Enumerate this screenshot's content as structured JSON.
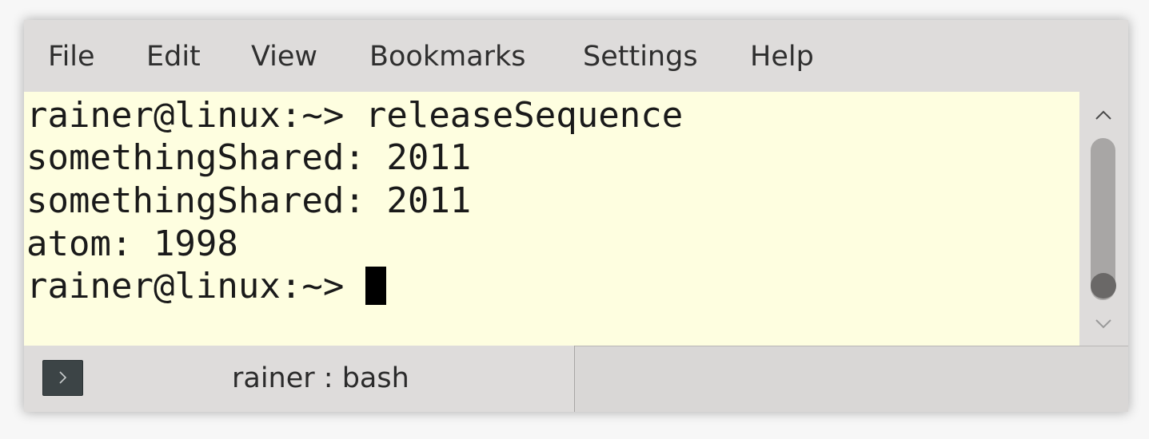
{
  "menubar": {
    "items": [
      {
        "label": "File"
      },
      {
        "label": "Edit"
      },
      {
        "label": "View"
      },
      {
        "label": "Bookmarks"
      },
      {
        "label": "Settings"
      },
      {
        "label": "Help"
      }
    ]
  },
  "terminal": {
    "lines": [
      "rainer@linux:~> releaseSequence",
      "somethingShared: 2011",
      "somethingShared: 2011",
      "atom: 1998"
    ],
    "prompt": "rainer@linux:~> ",
    "background_color": "#fefee0",
    "text_color": "#1a1a1a"
  },
  "scrollbar": {
    "up_icon": "chevron-up-icon",
    "down_icon": "chevron-down-icon"
  },
  "tabs": [
    {
      "label": "rainer : bash",
      "icon": "terminal-prompt-icon",
      "active": true
    }
  ]
}
